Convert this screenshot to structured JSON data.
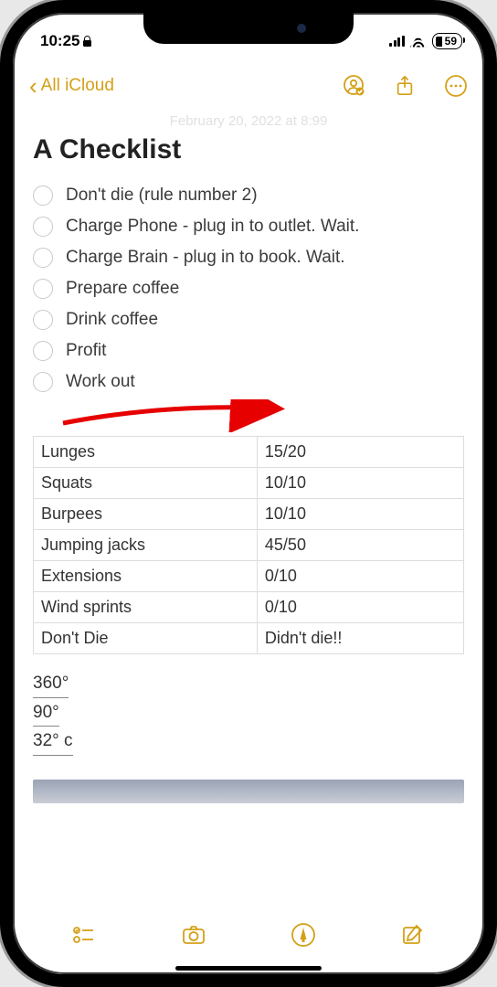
{
  "status": {
    "time": "10:25",
    "battery": "59"
  },
  "nav": {
    "back_label": "All iCloud"
  },
  "ghost_date": "February 20, 2022 at 8:99",
  "title": "A Checklist",
  "checklist": [
    "Don't die (rule number 2)",
    "Charge Phone - plug in to outlet. Wait.",
    "Charge Brain - plug in to book. Wait.",
    "Prepare coffee",
    "Drink coffee",
    "Profit",
    "Work out"
  ],
  "table": [
    {
      "name": "Lunges",
      "value": "15/20"
    },
    {
      "name": "Squats",
      "value": "10/10"
    },
    {
      "name": "Burpees",
      "value": "10/10"
    },
    {
      "name": "Jumping jacks",
      "value": "45/50"
    },
    {
      "name": "Extensions",
      "value": "0/10"
    },
    {
      "name": "Wind sprints",
      "value": "0/10"
    },
    {
      "name": "Don't Die",
      "value": "Didn't die!!"
    }
  ],
  "temps": [
    "360°",
    "90°",
    "32° c"
  ]
}
